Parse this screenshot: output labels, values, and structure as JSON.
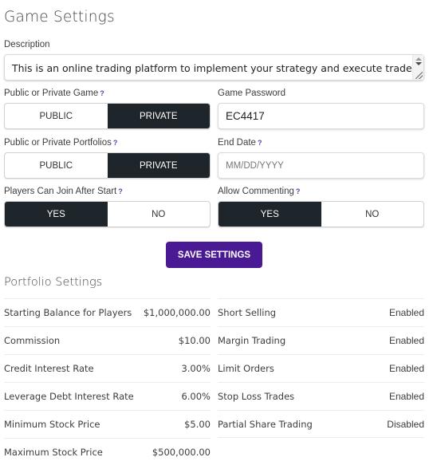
{
  "page_title": "Game Settings",
  "description": {
    "label": "Description",
    "value": "This is an online trading platform to implement your strategy and execute trades."
  },
  "help_glyph": "?",
  "game_visibility": {
    "label": "Public or Private Game",
    "options": [
      "PUBLIC",
      "PRIVATE"
    ],
    "selected": "PRIVATE"
  },
  "game_password": {
    "label": "Game Password",
    "value": "EC4417"
  },
  "portfolio_visibility": {
    "label": "Public or Private Portfolios",
    "options": [
      "PUBLIC",
      "PRIVATE"
    ],
    "selected": "PRIVATE"
  },
  "end_date": {
    "label": "End Date",
    "placeholder": "MM/DD/YYYY",
    "value": ""
  },
  "join_after_start": {
    "label": "Players Can Join After Start",
    "options": [
      "YES",
      "NO"
    ],
    "selected": "YES"
  },
  "allow_commenting": {
    "label": "Allow Commenting",
    "options": [
      "YES",
      "NO"
    ],
    "selected": "YES"
  },
  "save_button": "SAVE SETTINGS",
  "colors": {
    "primary": "#4a1a94",
    "toggle_active": "#1f262b",
    "help": "#5a3fa8"
  },
  "portfolio_settings": {
    "title": "Portfolio Settings",
    "left": [
      {
        "label": "Starting Balance for Players",
        "value": "$1,000,000.00"
      },
      {
        "label": "Commission",
        "value": "$10.00"
      },
      {
        "label": "Credit Interest Rate",
        "value": "3.00%"
      },
      {
        "label": "Leverage Debt Interest Rate",
        "value": "6.00%"
      },
      {
        "label": "Minimum Stock Price",
        "value": "$5.00"
      },
      {
        "label": "Maximum Stock Price",
        "value": "$500,000.00"
      }
    ],
    "right": [
      {
        "label": "Short Selling",
        "value": "Enabled"
      },
      {
        "label": "Margin Trading",
        "value": "Enabled"
      },
      {
        "label": "Limit Orders",
        "value": "Enabled"
      },
      {
        "label": "Stop Loss Trades",
        "value": "Enabled"
      },
      {
        "label": "Partial Share Trading",
        "value": "Disabled"
      }
    ]
  }
}
